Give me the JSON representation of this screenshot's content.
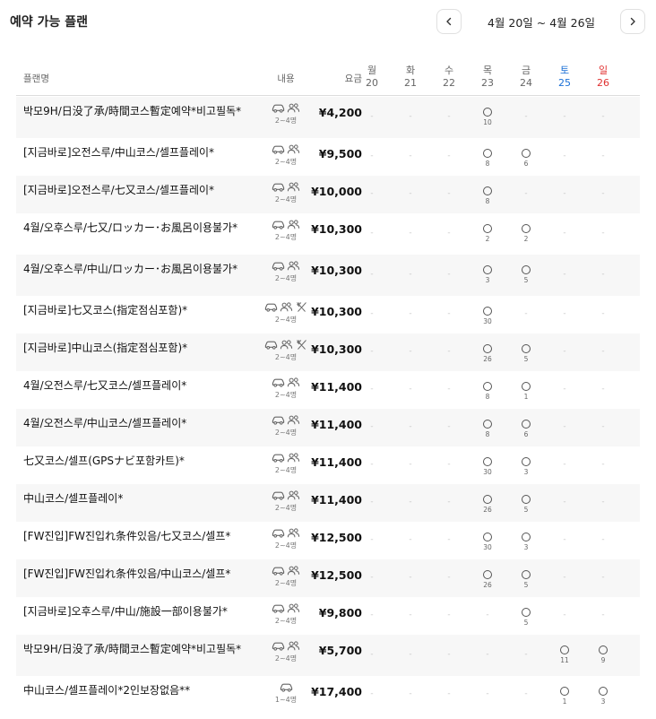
{
  "header": {
    "title": "예약 가능 플랜",
    "date_range": "4월 20일 ~ 4월 26일",
    "prev_icon": "chevron-left-icon",
    "next_icon": "chevron-right-icon"
  },
  "table": {
    "columns": {
      "plan": "플랜명",
      "content": "내용",
      "price": "요금"
    },
    "days": [
      {
        "dow": "월",
        "date": "20",
        "color": "#666666"
      },
      {
        "dow": "화",
        "date": "21",
        "color": "#666666"
      },
      {
        "dow": "수",
        "date": "22",
        "color": "#666666"
      },
      {
        "dow": "목",
        "date": "23",
        "color": "#666666"
      },
      {
        "dow": "금",
        "date": "24",
        "color": "#666666"
      },
      {
        "dow": "토",
        "date": "25",
        "color": "#1a6fd6"
      },
      {
        "dow": "일",
        "date": "26",
        "color": "#e03131"
      }
    ],
    "dash": "-",
    "rows": [
      {
        "name": "박모9H/日没了承/時間코스暫定예약*비고필독*",
        "icons": [
          "cart-icon",
          "people-icon"
        ],
        "capacity": "2~4명",
        "price": "¥4,200",
        "slots": [
          null,
          null,
          null,
          "10",
          null,
          null,
          null
        ]
      },
      {
        "name": "[지금바로]오전스루/中山코스/셀프플레이*",
        "icons": [
          "cart-icon",
          "people-icon"
        ],
        "capacity": "2~4명",
        "price": "¥9,500",
        "slots": [
          null,
          null,
          null,
          "8",
          "6",
          null,
          null
        ]
      },
      {
        "name": "[지금바로]오전스루/七又코스/셀프플레이*",
        "icons": [
          "cart-icon",
          "people-icon"
        ],
        "capacity": "2~4명",
        "price": "¥10,000",
        "slots": [
          null,
          null,
          null,
          "8",
          null,
          null,
          null
        ]
      },
      {
        "name": "4월/오후스루/七又/ロッカー･お風呂이용불가*",
        "icons": [
          "cart-icon",
          "people-icon"
        ],
        "capacity": "2~4명",
        "price": "¥10,300",
        "slots": [
          null,
          null,
          null,
          "2",
          "2",
          null,
          null
        ]
      },
      {
        "name": "4월/오후스루/中山/ロッカー･お風呂이용불가*",
        "icons": [
          "cart-icon",
          "people-icon"
        ],
        "capacity": "2~4명",
        "price": "¥10,300",
        "slots": [
          null,
          null,
          null,
          "3",
          "5",
          null,
          null
        ]
      },
      {
        "name": "[지금바로]七又코스(指定점심포함)*",
        "icons": [
          "cart-icon",
          "people-icon",
          "meal-icon"
        ],
        "capacity": "2~4명",
        "price": "¥10,300",
        "slots": [
          null,
          null,
          null,
          "30",
          null,
          null,
          null
        ]
      },
      {
        "name": "[지금바로]中山코스(指定점심포함)*",
        "icons": [
          "cart-icon",
          "people-icon",
          "meal-icon"
        ],
        "capacity": "2~4명",
        "price": "¥10,300",
        "slots": [
          null,
          null,
          null,
          "26",
          "5",
          null,
          null
        ]
      },
      {
        "name": "4월/오전스루/七又코스/셀프플레이*",
        "icons": [
          "cart-icon",
          "people-icon"
        ],
        "capacity": "2~4명",
        "price": "¥11,400",
        "slots": [
          null,
          null,
          null,
          "8",
          "1",
          null,
          null
        ]
      },
      {
        "name": "4월/오전스루/中山코스/셀프플레이*",
        "icons": [
          "cart-icon",
          "people-icon"
        ],
        "capacity": "2~4명",
        "price": "¥11,400",
        "slots": [
          null,
          null,
          null,
          "8",
          "6",
          null,
          null
        ]
      },
      {
        "name": "七又코스/셀프(GPSナビ포함카트)*",
        "icons": [
          "cart-icon",
          "people-icon"
        ],
        "capacity": "2~4명",
        "price": "¥11,400",
        "slots": [
          null,
          null,
          null,
          "30",
          "3",
          null,
          null
        ]
      },
      {
        "name": "中山코스/셀프플레이*",
        "icons": [
          "cart-icon",
          "people-icon"
        ],
        "capacity": "2~4명",
        "price": "¥11,400",
        "slots": [
          null,
          null,
          null,
          "26",
          "5",
          null,
          null
        ]
      },
      {
        "name": "[FW진입]FW진입れ条件있음/七又코스/셀프*",
        "icons": [
          "cart-icon",
          "people-icon"
        ],
        "capacity": "2~4명",
        "price": "¥12,500",
        "slots": [
          null,
          null,
          null,
          "30",
          "3",
          null,
          null
        ]
      },
      {
        "name": "[FW진입]FW진입れ条件있음/中山코스/셀프*",
        "icons": [
          "cart-icon",
          "people-icon"
        ],
        "capacity": "2~4명",
        "price": "¥12,500",
        "slots": [
          null,
          null,
          null,
          "26",
          "5",
          null,
          null
        ]
      },
      {
        "name": "[지금바로]오후스루/中山/施設一部이용불가*",
        "icons": [
          "cart-icon",
          "people-icon"
        ],
        "capacity": "2~4명",
        "price": "¥9,800",
        "slots": [
          null,
          null,
          null,
          null,
          "5",
          null,
          null
        ]
      },
      {
        "name": "박모9H/日没了承/時間코스暫定예약*비고필독*",
        "icons": [
          "cart-icon",
          "people-icon"
        ],
        "capacity": "2~4명",
        "price": "¥5,700",
        "slots": [
          null,
          null,
          null,
          null,
          null,
          "11",
          "9"
        ]
      },
      {
        "name": "中山코스/셀프플레이*2인보장없음**",
        "icons": [
          "cart-icon"
        ],
        "capacity": "1~4명",
        "price": "¥17,400",
        "slots": [
          null,
          null,
          null,
          null,
          null,
          "1",
          "3"
        ]
      }
    ]
  }
}
